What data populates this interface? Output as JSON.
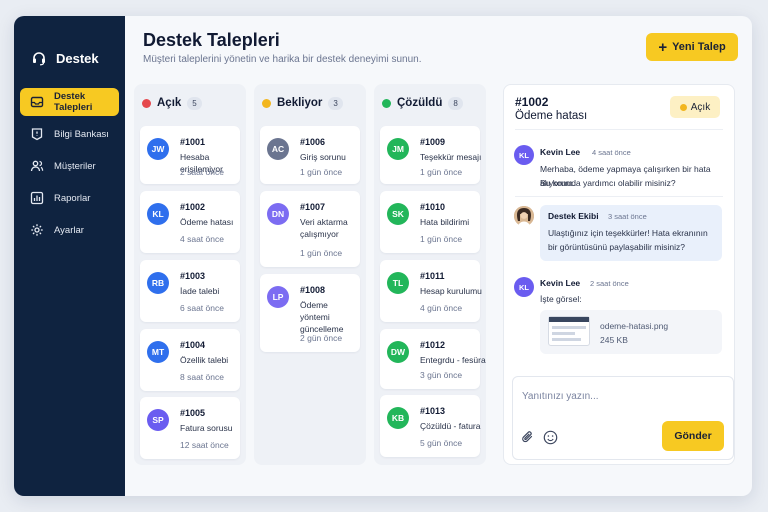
{
  "sidebar": {
    "brand": "Destek",
    "items": [
      {
        "label": "Destek Talepleri",
        "icon": "inbox-icon",
        "active": true
      },
      {
        "label": "Bilgi Bankası",
        "icon": "book-icon",
        "active": false
      },
      {
        "label": "Müşteriler",
        "icon": "users-icon",
        "active": false
      },
      {
        "label": "Raporlar",
        "icon": "chart-icon",
        "active": false
      },
      {
        "label": "Ayarlar",
        "icon": "gear-icon",
        "active": false
      }
    ]
  },
  "header": {
    "title": "Destek Talepleri",
    "subtitle": "Müşteri taleplerini yönetin ve harika bir destek deneyimi sunun.",
    "new_button": "Yeni Talep"
  },
  "columns": [
    {
      "title": "Açık",
      "count": "5",
      "color": "#e5484d",
      "cards": [
        {
          "initials": "JW",
          "id": "#1001",
          "subject": "Hesaba erişilemiyor",
          "time": "2 saat önce",
          "color": "#2f6fed"
        },
        {
          "initials": "KL",
          "id": "#1002",
          "subject": "Ödeme hatası",
          "time": "4 saat önce",
          "color": "#2f6fed"
        },
        {
          "initials": "RB",
          "id": "#1003",
          "subject": "İade talebi",
          "time": "6 saat önce",
          "color": "#2f6fed"
        },
        {
          "initials": "MT",
          "id": "#1004",
          "subject": "Özellik talebi",
          "time": "8 saat önce",
          "color": "#2f6fed"
        },
        {
          "initials": "SP",
          "id": "#1005",
          "subject": "Fatura sorusu",
          "time": "12 saat önce",
          "color": "#6a5cf0"
        }
      ]
    },
    {
      "title": "Bekliyor",
      "count": "3",
      "color": "#f2b61f",
      "cards": [
        {
          "initials": "AC",
          "id": "#1006",
          "subject": "Giriş sorunu",
          "time": "1 gün önce",
          "color": "#6b7590"
        },
        {
          "initials": "DN",
          "id": "#1007",
          "subject": "Veri aktarma çalışmıyor",
          "time": "1 gün önce",
          "color": "#7c6cf2"
        },
        {
          "initials": "LP",
          "id": "#1008",
          "subject": "Ödeme yöntemi güncelleme",
          "time": "2 gün önce",
          "color": "#7c6cf2"
        }
      ]
    },
    {
      "title": "Çözüldü",
      "count": "8",
      "color": "#22b65a",
      "cards": [
        {
          "initials": "JM",
          "id": "#1009",
          "subject": "Teşekkür mesajı",
          "time": "1 gün önce",
          "color": "#22b65a"
        },
        {
          "initials": "SK",
          "id": "#1010",
          "subject": "Hata bildirimi",
          "time": "1 gün önce",
          "color": "#22b65a"
        },
        {
          "initials": "TL",
          "id": "#1011",
          "subject": "Hesap kurulumu",
          "time": "4 gün önce",
          "color": "#22b65a"
        },
        {
          "initials": "DW",
          "id": "#1012",
          "subject": "Entegrdu - fesüra",
          "time": "3 gün önce",
          "color": "#22b65a"
        },
        {
          "initials": "KB",
          "id": "#1013",
          "subject": "Çözüldü - fatura",
          "time": "5 gün önce",
          "color": "#22b65a"
        }
      ]
    }
  ],
  "detail": {
    "id": "#1002",
    "subject": "Ödeme hatası",
    "status": "Açık",
    "status_color": "#f2b61f",
    "messages": [
      {
        "initials": "KL",
        "name": "Kevin Lee",
        "time": "4 saat önce",
        "text1": "Merhaba, ödeme yapmaya çalışırken bir hata alıyorum.",
        "text2": "Bu konuda yardımcı olabilir misiniz?"
      },
      {
        "initials": "",
        "name": "Destek Ekibi",
        "time": "3 saat önce",
        "text1": "Ulaştığınız için teşekkürler! Hata ekranının",
        "text2": "bir görüntüsünü paylaşabilir misiniz?"
      },
      {
        "initials": "KL",
        "name": "Kevin Lee",
        "time": "2 saat önce",
        "text1": "İşte görsel:",
        "text2": ""
      }
    ],
    "attachment": {
      "name": "odeme-hatasi.png",
      "size": "245 KB"
    },
    "reply_placeholder": "Yanıtınızı yazın...",
    "send_label": "Gönder"
  }
}
